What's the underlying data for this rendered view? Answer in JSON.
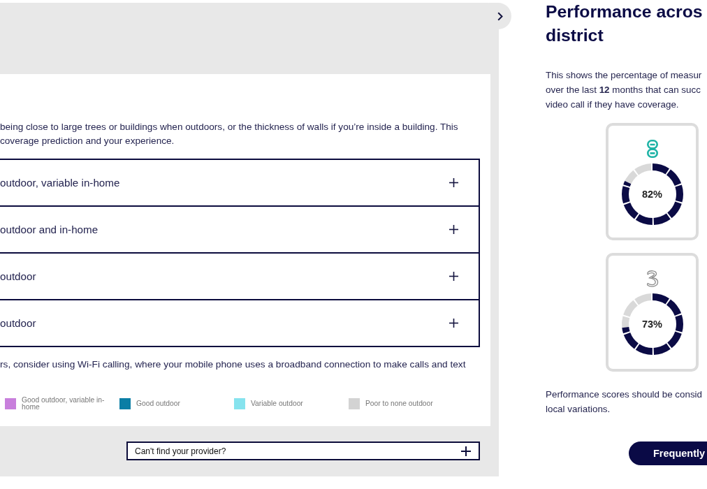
{
  "coverage_panel": {
    "intro": "being close to large trees or buildings when outdoors, or the thickness of walls if you’re inside a building. This\ncoverage prediction and your experience.",
    "accordion": [
      {
        "label": "outdoor, variable in-home",
        "expanded": false
      },
      {
        "label": "outdoor and in-home",
        "expanded": false
      },
      {
        "label": "outdoor",
        "expanded": false
      },
      {
        "label": "outdoor",
        "expanded": false
      }
    ],
    "wifi_note": "rs, consider using Wi-Fi calling, where your mobile phone uses a broadband connection to make calls and text",
    "legend": [
      {
        "label": "Good outdoor, variable in-home",
        "color": "#c87fdc"
      },
      {
        "label": "Good outdoor",
        "color": "#0b7ea5"
      },
      {
        "label": "Variable outdoor",
        "color": "#86e3ee"
      },
      {
        "label": "Poor to none outdoor",
        "color": "#d3d3d3"
      }
    ],
    "provider_search": {
      "label": "Can't find your provider?",
      "expanded": false
    }
  },
  "performance": {
    "title": "Performance acros\ndistrict",
    "description": "This shows the percentage of measur\nover the last **12** months that can succ\nvideo call if they have coverage.",
    "operators": [
      {
        "kind": "loops",
        "level": 0.82,
        "reading": "82%"
      },
      {
        "kind": "swirl",
        "level": 0.73,
        "reading": "73%"
      }
    ],
    "note": "Performance scores should be consid\nlocal variations.",
    "faq_button": "Frequently"
  }
}
